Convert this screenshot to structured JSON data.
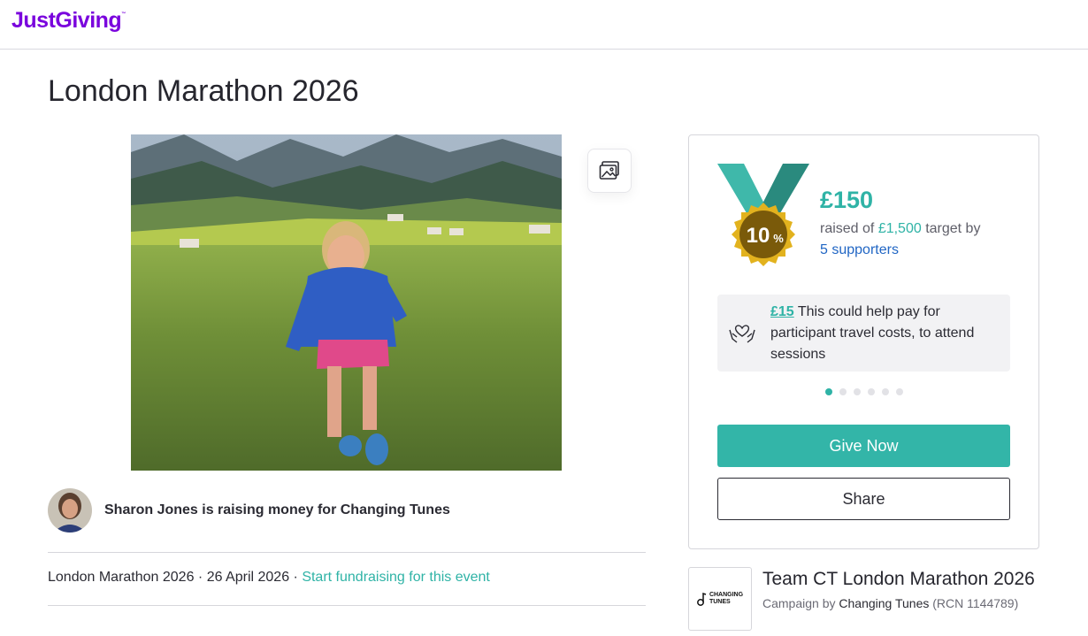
{
  "brand": {
    "logo_text": "JustGiving",
    "trademark": "™",
    "color": "#7a04dd"
  },
  "page": {
    "title": "London Marathon 2026"
  },
  "hero": {
    "alt": "Fundraiser photo",
    "gallery_icon": "image-gallery-icon"
  },
  "owner": {
    "text": "Sharon Jones is raising money for Changing Tunes"
  },
  "event": {
    "name": "London Marathon 2026",
    "separator": " · ",
    "date": "26 April 2026",
    "link": "Start fundraising for this event"
  },
  "progress": {
    "percent_number": "10",
    "percent_sign": "%",
    "amount": "£150",
    "raised_prefix": "raised of ",
    "target": "£1,500",
    "target_suffix": " target by",
    "supporters": "5 supporters"
  },
  "impact": {
    "icon": "heart-hands-icon",
    "amount": "£15",
    "text": " This could help pay for participant travel costs, to attend sessions"
  },
  "carousel": {
    "count": 6,
    "active_index": 0
  },
  "buttons": {
    "give": "Give Now",
    "share": "Share"
  },
  "campaign": {
    "logo_line1": "CHANGING",
    "logo_line2": "TUNES",
    "title": "Team CT London Marathon 2026",
    "by_prefix": "Campaign by ",
    "org": "Changing Tunes",
    "rcn": " (RCN 1144789)"
  },
  "colors": {
    "accent": "#2fb3a6",
    "link_blue": "#2166c4",
    "medal_gold": "#d6a91a"
  }
}
